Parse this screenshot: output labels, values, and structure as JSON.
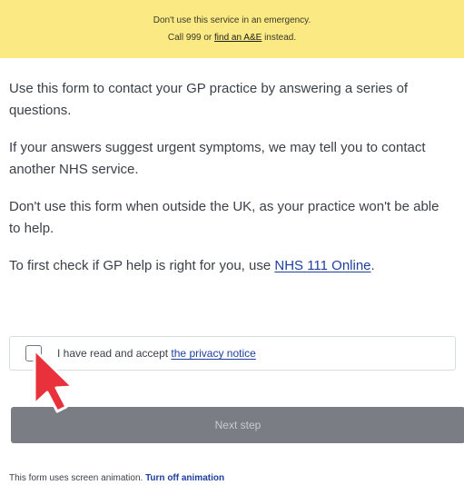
{
  "banner": {
    "line1": "Don't use this service in an emergency.",
    "line2_prefix": "Call 999 or ",
    "line2_link": "find an A&E",
    "line2_suffix": " instead."
  },
  "intro": {
    "p1": "Use this form to contact your GP practice by answering a series of questions.",
    "p2": "If your answers suggest urgent symptoms, we may tell you to contact another NHS service.",
    "p3": "Don't use this form when outside the UK, as your practice won't be able to help.",
    "p4_prefix": "To first check if GP help is right for you, use ",
    "p4_link": "NHS 111 Online",
    "p4_suffix": "."
  },
  "consent": {
    "label_prefix": "I have read and accept ",
    "label_link": "the privacy notice",
    "checked": false
  },
  "next_button": {
    "label": "Next step"
  },
  "footer": {
    "text": "This form uses screen animation. ",
    "link": "Turn off animation"
  },
  "colors": {
    "banner_bg": "#fbe983",
    "link": "#1d3fa0",
    "button_bg": "#7b7d85",
    "cursor": "#e8313a"
  },
  "icons": {
    "cursor": "pointer-arrow-icon"
  }
}
